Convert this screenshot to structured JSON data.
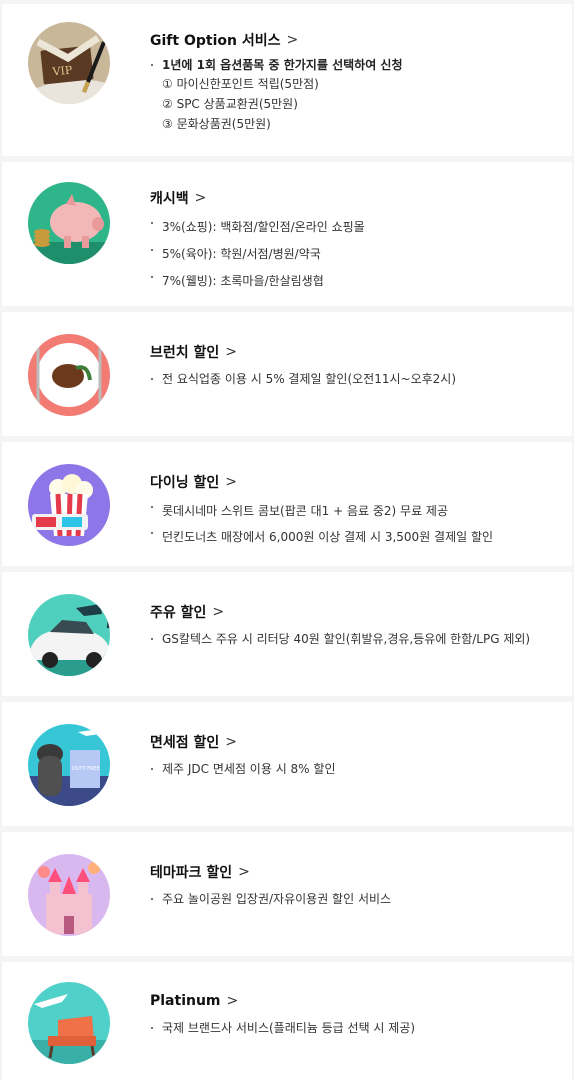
{
  "benefits": [
    {
      "title": "Gift Option 서비스",
      "image": "vip-card-pen",
      "items": [
        "1년에 1회 옵션품목 중 한가지를 선택하여 신청"
      ],
      "subitems": [
        "① 마이신한포인트 적립(5만점)",
        "② SPC 상품교환권(5만원)",
        "③ 문화상품권(5만원)"
      ]
    },
    {
      "title": "캐시백",
      "image": "piggy-bank",
      "items": [
        "3%(쇼핑): 백화점/할인점/온라인 쇼핑몰",
        "5%(육아): 학원/서점/병원/약국",
        "7%(웰빙): 초록마을/한살림생협"
      ]
    },
    {
      "title": "브런치 할인",
      "image": "steak-plate",
      "items": [
        "전 요식업종 이용 시 5% 결제일 할인(오전11시~오후2시)"
      ]
    },
    {
      "title": "다이닝 할인",
      "image": "popcorn-3d-glasses",
      "items": [
        "롯데시네마 스위트 콤보(팝콘 대1 + 음료 중2) 무료 제공",
        "던킨도너츠 매장에서 6,000원 이상 결제 시 3,500원 결제일 할인"
      ]
    },
    {
      "title": "주유 할인",
      "image": "car-fuel-nozzle",
      "items": [
        "GS칼텍스 주유 시 리터당 40원 할인(휘발유,경유,등유에 한함/LPG 제외)"
      ]
    },
    {
      "title": "면세점 할인",
      "image": "dolharubang-airplane-bag",
      "bag_label": "DUTY FREE",
      "items": [
        "제주 JDC 면세점 이용 시 8% 할인"
      ]
    },
    {
      "title": "테마파크 할인",
      "image": "castle-balloons",
      "items": [
        "주요 놀이공원 입장권/자유이용권 할인 서비스"
      ]
    },
    {
      "title": "Platinum",
      "image": "airplane-lounge-chair",
      "items": [
        "국제 브랜드사 서비스(플래티늄 등급 선택 시 제공)"
      ]
    }
  ],
  "vip_label": "VIP",
  "chevron": ">"
}
